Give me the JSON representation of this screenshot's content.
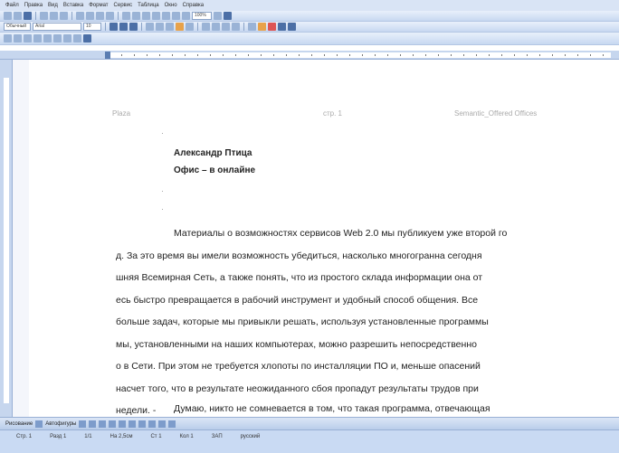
{
  "menubar": {
    "items": [
      "Файл",
      "Правка",
      "Вид",
      "Вставка",
      "Формат",
      "Сервис",
      "Таблица",
      "Окно",
      "Справка"
    ]
  },
  "formatting": {
    "style": "Обычный",
    "font": "Arial",
    "size": "10",
    "zoom": "100%"
  },
  "document": {
    "header_left": "Plaza",
    "header_center": "стр. 1",
    "header_right": "Semantic_Offered Offices",
    "author": "Александр Птица",
    "subtitle": "Офис – в онлайне",
    "body_lines": [
      "Материалы о возможностях сервисов Web 2.0 мы публикуем уже второй го",
      "д. За это время вы имели возможность убедиться, насколько многогранна сегодня",
      "шняя Всемирная Сеть, а также понять, что из простого склада информации она от",
      "есь быстро превращается в рабочий инструмент и удобный способ общения. Все",
      "больше задач, которые мы привыкли решать, используя установленные программы",
      "мы, установленными на наших компьютерах, можно разрешить непосредственно",
      "о в Сети. При этом не требуется хлопоты по инсталляции ПО и, меньше опасений",
      "насчет того, что в результате неожиданного сбоя пропадут результаты трудов при",
      "недели. -"
    ],
    "para2": "Думаю, никто не сомневается в том, что такая программа, отвечающая"
  },
  "drawing_toolbar": {
    "draw_label": "Рисование",
    "autoshapes_label": "Автофигуры"
  },
  "statusbar": {
    "items": [
      "Стр. 1",
      "Разд 1",
      "1/1",
      "На 2,5см",
      "Ст 1",
      "Кол 1",
      "ЗАП",
      "русский"
    ]
  }
}
